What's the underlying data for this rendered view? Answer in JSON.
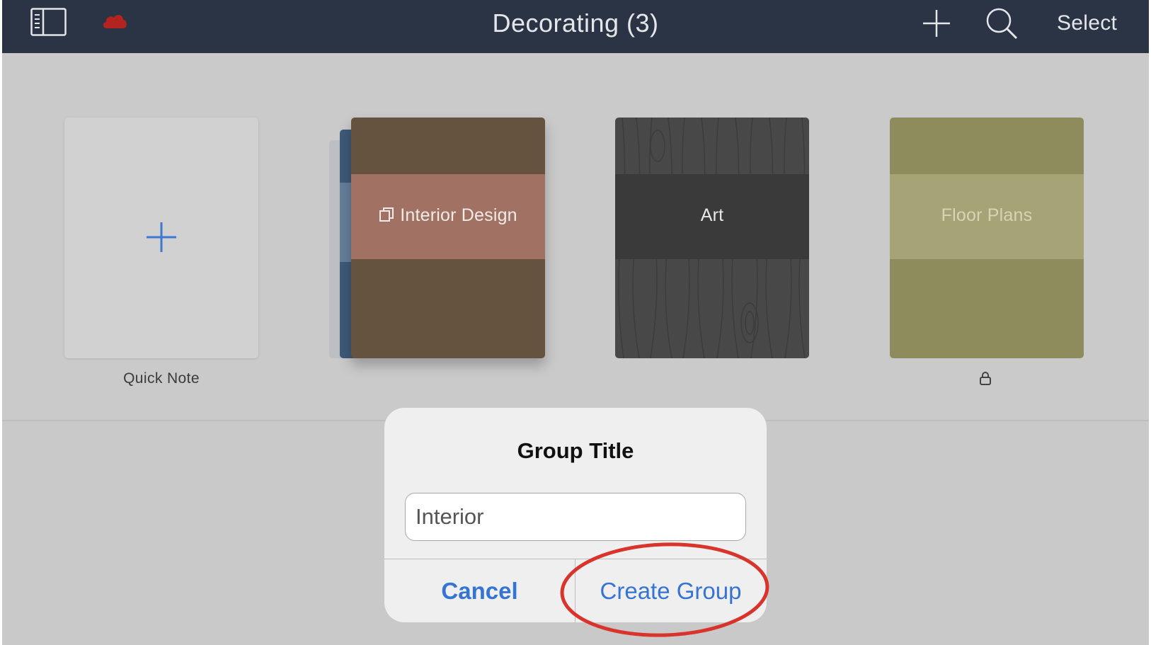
{
  "header": {
    "title": "Decorating (3)",
    "select_label": "Select",
    "left_icons": [
      "sidebar-icon",
      "cloud-icon"
    ],
    "right_icons": [
      "plus-icon",
      "search-icon"
    ],
    "background_color": "#2b3444",
    "cloud_color": "#b3231f"
  },
  "notebooks": [
    {
      "title": "",
      "label": "Quick Note",
      "type": "quick-note",
      "icon": "plus-icon"
    },
    {
      "title": "Interior Design",
      "label": "",
      "type": "group",
      "icon": "group-icon",
      "cover_color": "#65533f",
      "band_color": "#a17263"
    },
    {
      "title": "Art",
      "label": "",
      "type": "notebook",
      "cover_color": "#484848",
      "band_color": "#3a3a3a"
    },
    {
      "title": "Floor Plans",
      "label": "",
      "type": "notebook",
      "locked": true,
      "icon": "lock-icon",
      "cover_color": "#8e8b5c",
      "band_color": "#a5a477"
    }
  ],
  "dialog": {
    "title": "Group Title",
    "input_value": "Interior",
    "cancel_label": "Cancel",
    "create_label": "Create Group",
    "button_color": "#3574d3"
  },
  "annotation": {
    "shape": "ellipse",
    "target": "create-group-button",
    "color": "#d9342b"
  }
}
